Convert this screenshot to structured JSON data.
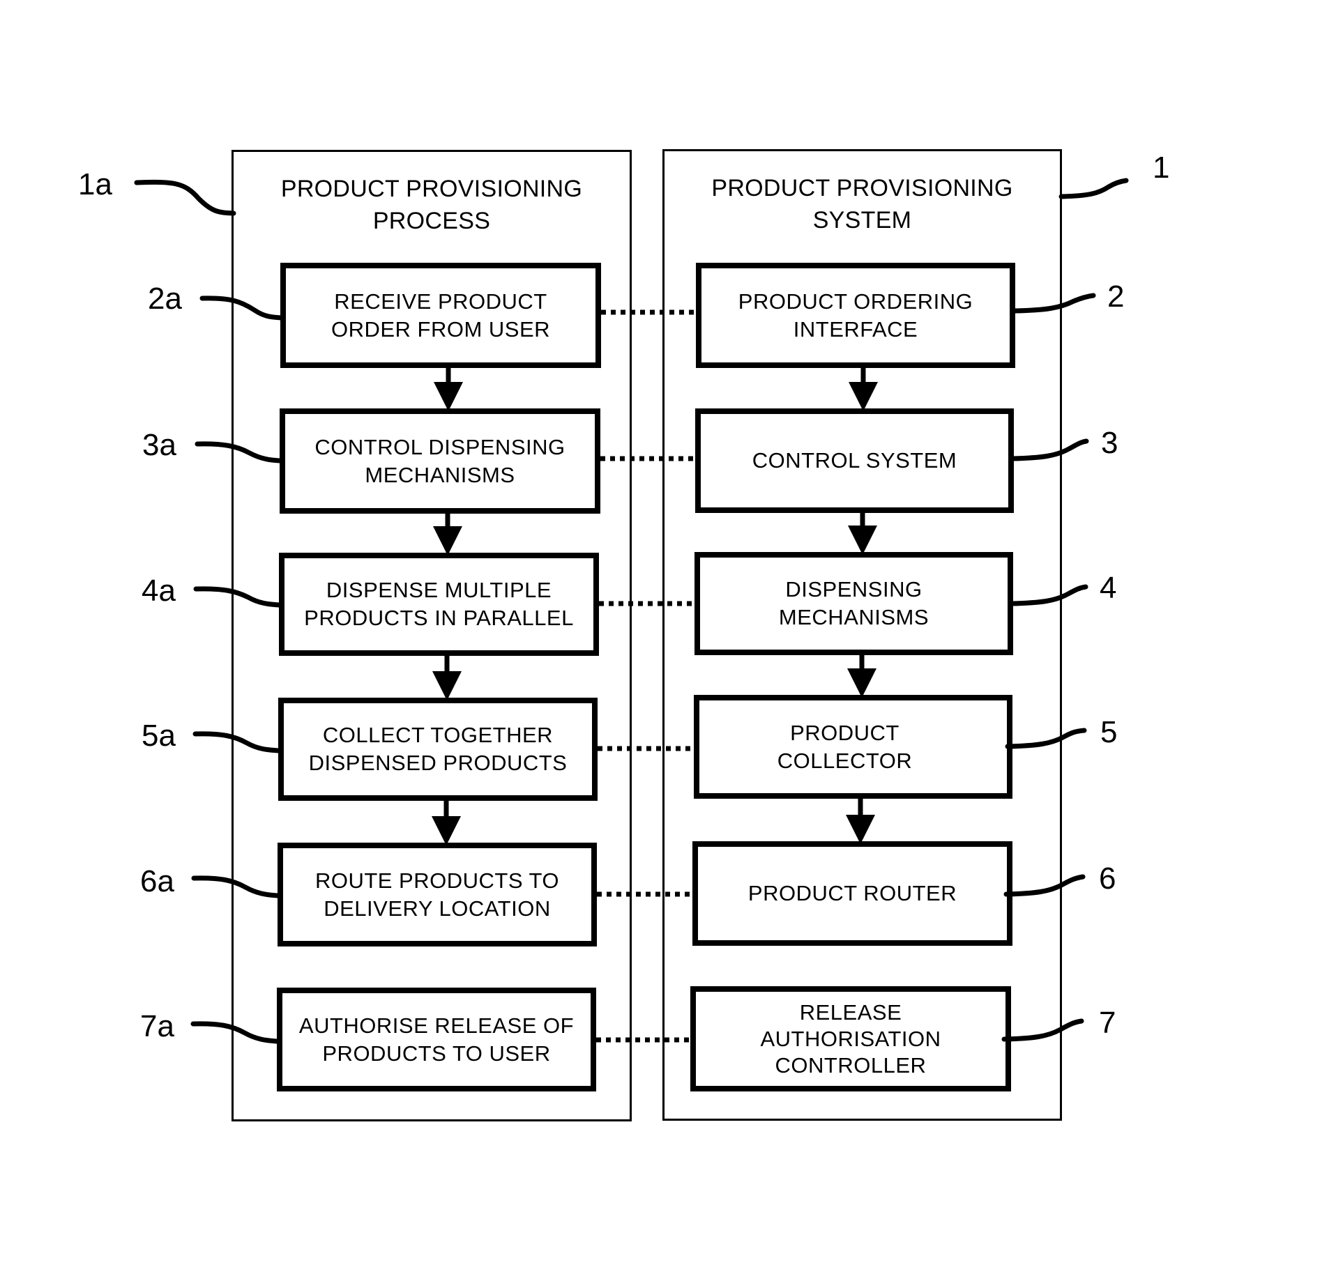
{
  "diagram": {
    "left_panel": {
      "ref": "1a",
      "title": "PRODUCT PROVISIONING\nPROCESS",
      "steps": [
        {
          "ref": "2a",
          "text": "RECEIVE PRODUCT\nORDER FROM USER"
        },
        {
          "ref": "3a",
          "text": "CONTROL DISPENSING\nMECHANISMS"
        },
        {
          "ref": "4a",
          "text": "DISPENSE MULTIPLE\nPRODUCTS IN PARALLEL"
        },
        {
          "ref": "5a",
          "text": "COLLECT TOGETHER\nDISPENSED PRODUCTS"
        },
        {
          "ref": "6a",
          "text": "ROUTE PRODUCTS TO\nDELIVERY LOCATION"
        },
        {
          "ref": "7a",
          "text": "AUTHORISE RELEASE OF\nPRODUCTS TO USER"
        }
      ]
    },
    "right_panel": {
      "ref": "1",
      "title": "PRODUCT PROVISIONING\nSYSTEM",
      "components": [
        {
          "ref": "2",
          "text": "PRODUCT ORDERING\nINTERFACE"
        },
        {
          "ref": "3",
          "text": "CONTROL SYSTEM"
        },
        {
          "ref": "4",
          "text": "DISPENSING\nMECHANISMS"
        },
        {
          "ref": "5",
          "text": "PRODUCT\nCOLLECTOR"
        },
        {
          "ref": "6",
          "text": "PRODUCT ROUTER"
        },
        {
          "ref": "7",
          "text": "RELEASE\nAUTHORISATION\nCONTROLLER"
        }
      ]
    },
    "flow_arrows": [
      {
        "from": "2a",
        "to": "3a"
      },
      {
        "from": "3a",
        "to": "4a"
      },
      {
        "from": "4a",
        "to": "5a"
      },
      {
        "from": "5a",
        "to": "6a"
      },
      {
        "from": "2",
        "to": "3"
      },
      {
        "from": "3",
        "to": "4"
      },
      {
        "from": "4",
        "to": "5"
      },
      {
        "from": "5",
        "to": "6"
      }
    ],
    "correspondences": [
      {
        "step": "2a",
        "component": "2"
      },
      {
        "step": "3a",
        "component": "3"
      },
      {
        "step": "4a",
        "component": "4"
      },
      {
        "step": "5a",
        "component": "5"
      },
      {
        "step": "6a",
        "component": "6"
      },
      {
        "step": "7a",
        "component": "7"
      }
    ]
  }
}
